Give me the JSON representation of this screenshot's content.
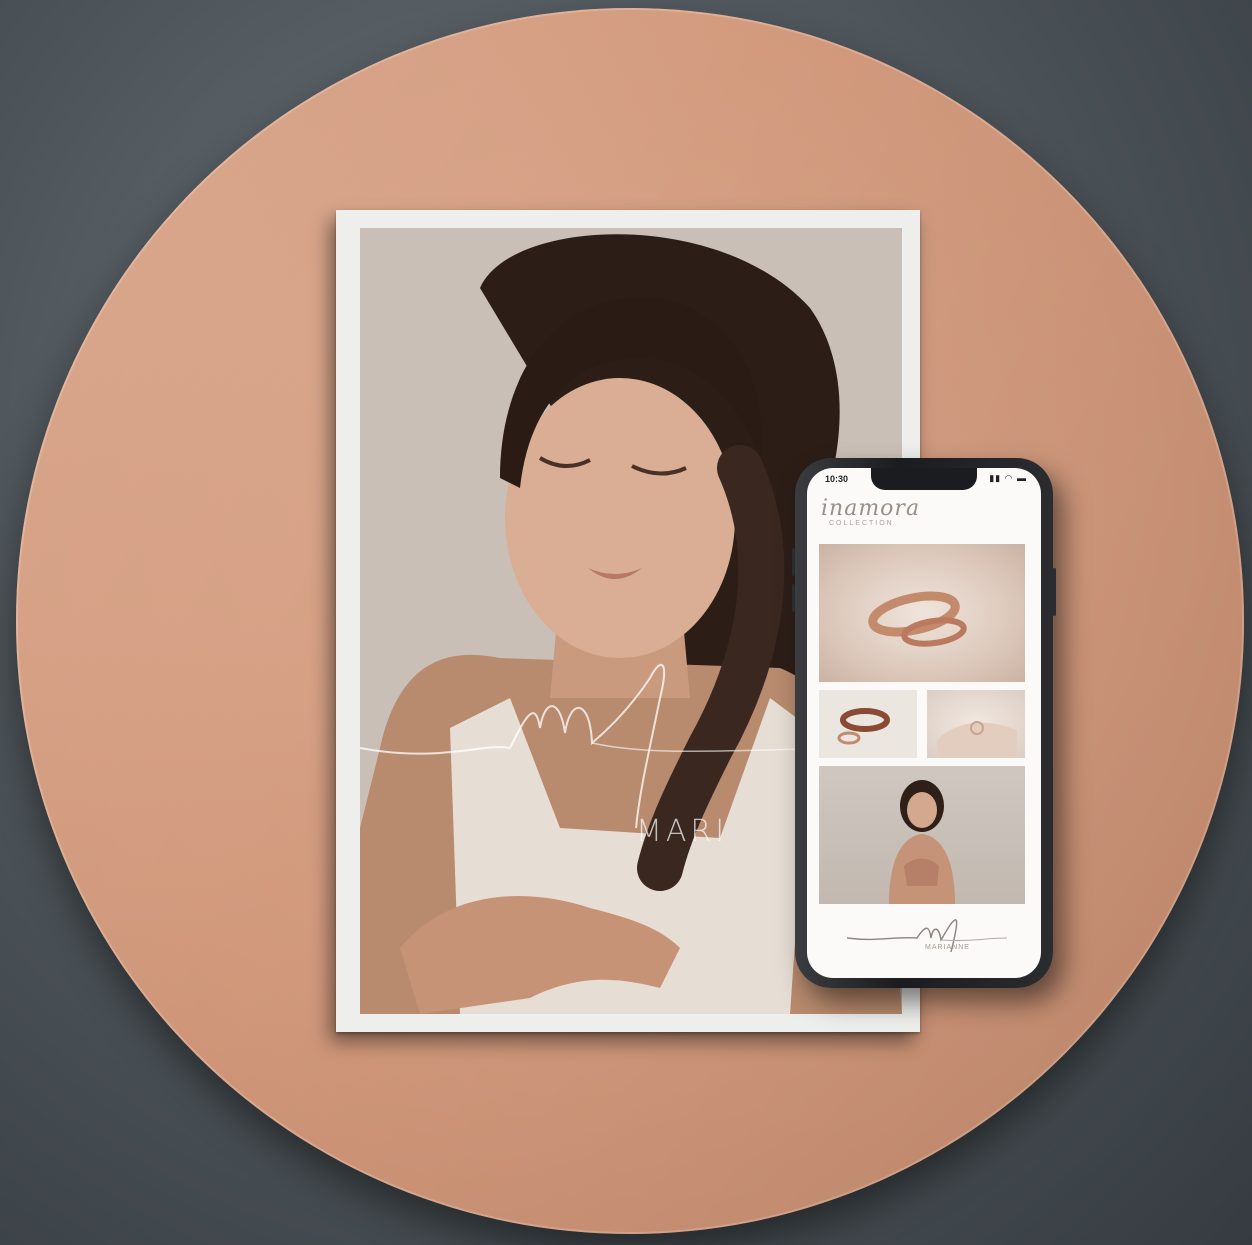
{
  "print": {
    "logo_monogram": "mf",
    "brand_text": "MARI"
  },
  "phone": {
    "status_time": "10:30",
    "status_icons": "▮▮ ◠ ▬",
    "app_title": "inamora",
    "app_subtitle": "COLLECTION",
    "footer_monogram": "mf",
    "footer_text": "MARIANNE"
  },
  "colors": {
    "background": "#4c5358",
    "disc": "#d2997c",
    "print_border": "#eeeeec",
    "phone_body": "#1b1c1f"
  }
}
